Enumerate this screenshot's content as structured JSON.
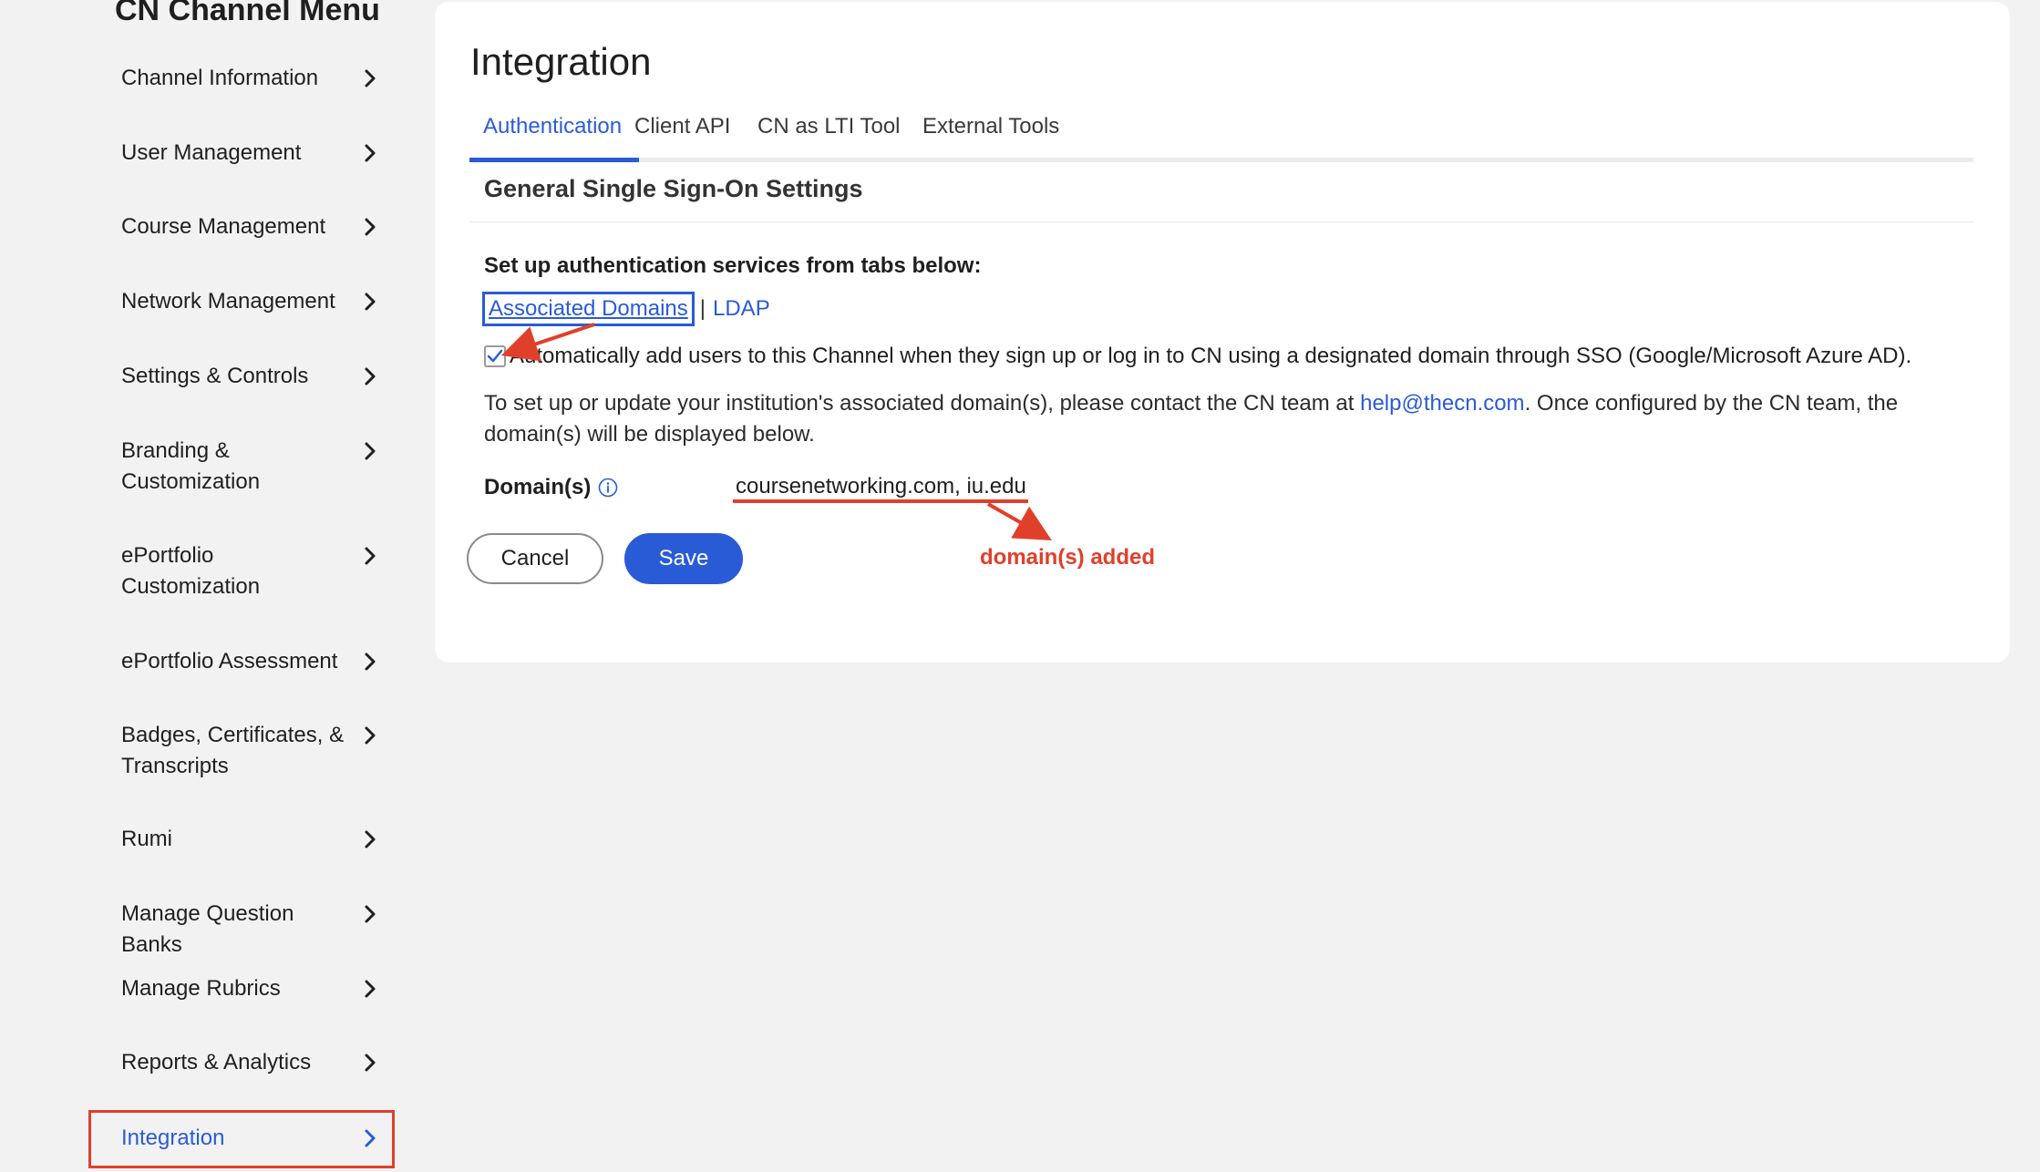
{
  "sidebar": {
    "title": "CN Channel Menu",
    "items": [
      {
        "label": "Channel Information"
      },
      {
        "label": "User Management"
      },
      {
        "label": "Course Management"
      },
      {
        "label": "Network Management"
      },
      {
        "label": "Settings & Controls"
      },
      {
        "label": "Branding & Customization"
      },
      {
        "label": "ePortfolio Customization"
      },
      {
        "label": "ePortfolio Assessment"
      },
      {
        "label": "Badges, Certificates, & Transcripts"
      },
      {
        "label": "Rumi"
      },
      {
        "label": "Manage Question Banks"
      },
      {
        "label": "Manage Rubrics"
      },
      {
        "label": "Reports & Analytics"
      },
      {
        "label": "Integration",
        "active": true
      }
    ]
  },
  "main": {
    "title": "Integration",
    "tabs": [
      {
        "label": "Authentication",
        "active": true
      },
      {
        "label": "Client API"
      },
      {
        "label": "CN as LTI Tool"
      },
      {
        "label": "External Tools"
      }
    ],
    "section_title": "General Single Sign-On Settings",
    "setup_label": "Set up authentication services from tabs below:",
    "auth_links": {
      "associated_domains": "Associated Domains",
      "separator": "|",
      "ldap": "LDAP"
    },
    "auto_add": {
      "checked": true,
      "label": "Automatically add users to this Channel when they sign up or log in to CN using a designated domain through SSO (Google/Microsoft Azure AD)."
    },
    "info": {
      "before": "To set up or update your institution's associated domain(s), please contact the CN team at ",
      "email": "help@thecn.com",
      "after": ". Once configured by the CN team, the domain(s) will be displayed below."
    },
    "domains": {
      "label": "Domain(s)",
      "value": "coursenetworking.com, iu.edu"
    },
    "buttons": {
      "cancel": "Cancel",
      "save": "Save"
    }
  },
  "annotations": {
    "domains_added": "domain(s) added"
  },
  "colors": {
    "accent": "#2a5bd7",
    "annotation": "#e0402b",
    "background": "#f2f2f2",
    "card": "#ffffff"
  }
}
